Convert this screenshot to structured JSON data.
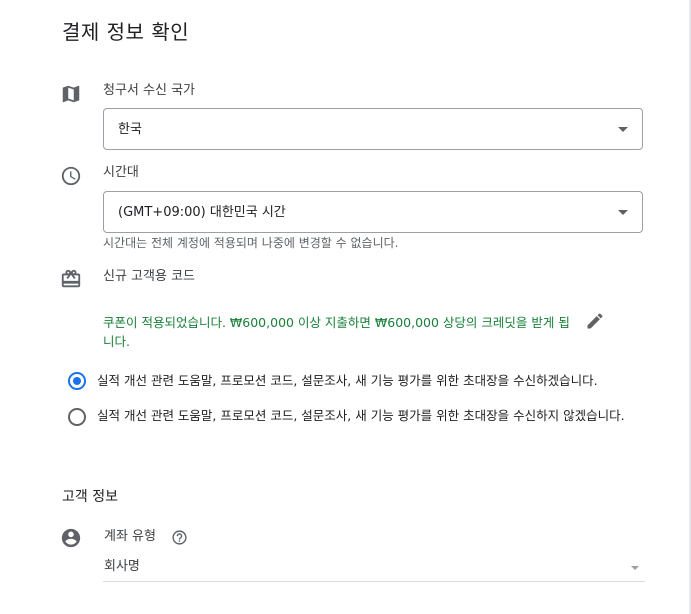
{
  "page": {
    "title": "결제 정보 확인"
  },
  "billing_country": {
    "label": "청구서 수신 국가",
    "value": "한국",
    "icon": "map-icon"
  },
  "timezone": {
    "label": "시간대",
    "value": "(GMT+09:00) 대한민국 시간",
    "helper": "시간대는 전체 계정에 적용되며 나중에 변경할 수 없습니다.",
    "icon": "clock-icon"
  },
  "coupon": {
    "label": "신규 고객용 코드",
    "message": "쿠폰이 적용되었습니다. ₩600,000 이상 지출하면 ₩600,000 상당의 크레딧을 받게 됩니다.",
    "icon": "gift-card-icon",
    "edit_icon": "pencil-icon",
    "message_color": "#188038"
  },
  "email_opt": {
    "options": [
      {
        "label": "실적 개선 관련 도움말, 프로모션 코드, 설문조사, 새 기능 평가를 위한 초대장을 수신하겠습니다.",
        "selected": true
      },
      {
        "label": "실적 개선 관련 도움말, 프로모션 코드, 설문조사, 새 기능 평가를 위한 초대장을 수신하지 않겠습니다.",
        "selected": false
      }
    ],
    "accent_color": "#1a73e8"
  },
  "customer_info": {
    "section_title": "고객 정보",
    "account_type": {
      "label": "계좌 유형",
      "value": "회사명",
      "icon": "account-circle-icon",
      "help_icon": "help-circle-icon"
    }
  }
}
